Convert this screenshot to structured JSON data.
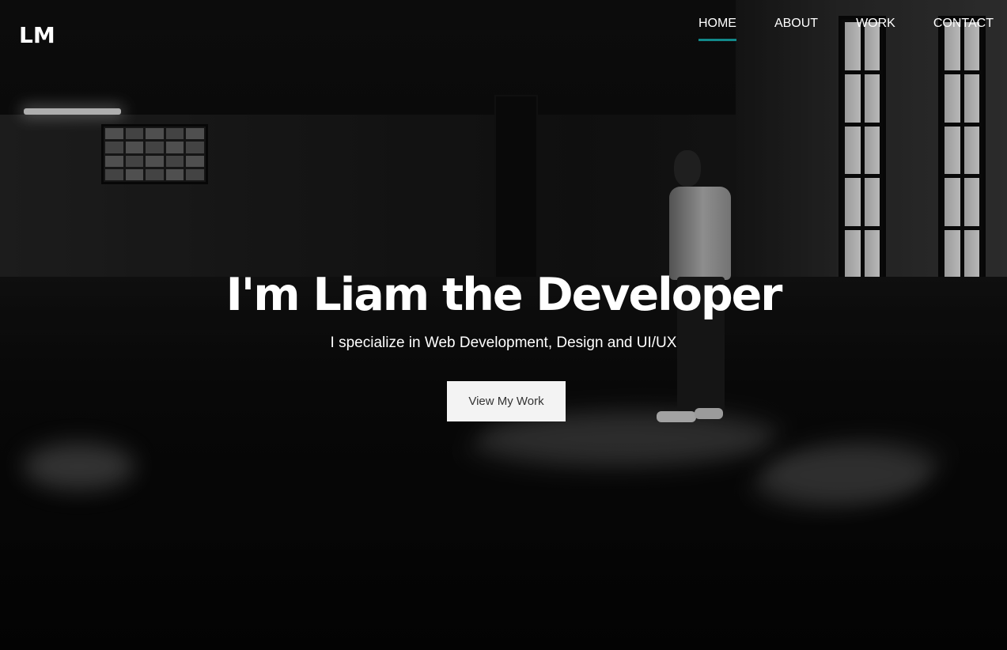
{
  "header": {
    "logo": "LM",
    "nav": [
      {
        "label": "HOME",
        "active": true
      },
      {
        "label": "ABOUT",
        "active": false
      },
      {
        "label": "WORK",
        "active": false
      },
      {
        "label": "CONTACT",
        "active": false
      }
    ]
  },
  "hero": {
    "title": "I'm Liam the Developer",
    "subtitle": "I specialize in Web Development, Design and UI/UX",
    "cta_label": "View My Work"
  },
  "colors": {
    "accent": "#12898a",
    "button_bg": "#f3f3f3",
    "button_text": "#333333"
  }
}
